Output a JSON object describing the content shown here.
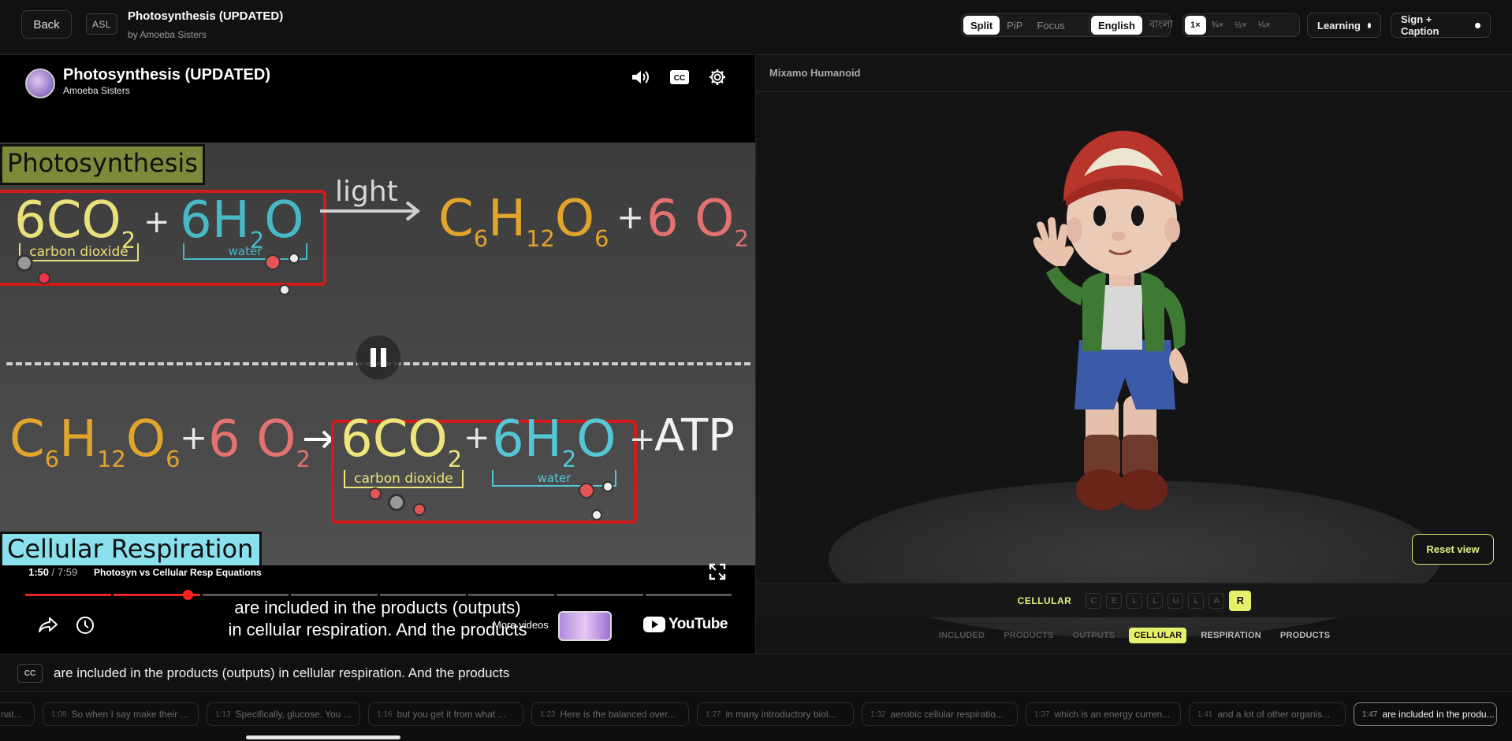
{
  "header": {
    "back_label": "Back",
    "asl_label": "ASL",
    "title": "Photosynthesis (UPDATED)",
    "byline": "by Amoeba Sisters",
    "view_modes": [
      "Split",
      "PiP",
      "Focus"
    ],
    "active_view": "Split",
    "languages": [
      "English",
      "বাংলা"
    ],
    "active_language": "English",
    "speeds": [
      "1×",
      "¾×",
      "½×",
      "¼×"
    ],
    "active_speed": "1×",
    "learning_label": "Learning",
    "sign_caption_label": "Sign + Caption"
  },
  "video": {
    "title": "Photosynthesis (UPDATED)",
    "channel": "Amoeba Sisters",
    "icons": [
      "volume-icon",
      "cc-icon",
      "settings-icon"
    ],
    "scene": {
      "label_top": "Photosynthesis",
      "label_bottom": "Cellular Respiration",
      "light": "light",
      "carbon_dioxide": "carbon dioxide",
      "water": "water",
      "atp": "ATP"
    },
    "current_time": "1:50",
    "duration": "7:59",
    "chapter": "Photosyn vs Cellular Resp Equations",
    "progress": 0.23,
    "caption_line1": "are included in the products (outputs)",
    "caption_line2": "in cellular respiration. And the products",
    "more_videos_label": "More videos",
    "youtube_label": "YouTube"
  },
  "avatar": {
    "title": "Mixamo Humanoid",
    "reset_label": "Reset view",
    "fingerspell_word": "CELLULAR",
    "fingerspell_letters": [
      "C",
      "E",
      "L",
      "L",
      "U",
      "L",
      "A",
      "R"
    ],
    "active_letter_index": 7,
    "glosses": [
      "INCLUDED",
      "PRODUCTS",
      "OUTPUTS",
      "CELLULAR",
      "RESPIRATION",
      "PRODUCTS"
    ],
    "active_gloss_index": 3
  },
  "caption_bar": {
    "cc_label": "CC",
    "text": "are included in the products (outputs) in cellular respiration. And the products"
  },
  "timeline": [
    {
      "time": "",
      "text": "nat..."
    },
    {
      "time": "1:08",
      "text": "So when I say make their ..."
    },
    {
      "time": "1:13",
      "text": "Specifically, glucose. You ..."
    },
    {
      "time": "1:16",
      "text": "but you get it from what ..."
    },
    {
      "time": "1:23",
      "text": "Here is the balanced over..."
    },
    {
      "time": "1:27",
      "text": "in many introductory biol..."
    },
    {
      "time": "1:32",
      "text": "aerobic cellular respiratio..."
    },
    {
      "time": "1:37",
      "text": "which is an energy curren..."
    },
    {
      "time": "1:41",
      "text": "and a lot of other organis..."
    },
    {
      "time": "1:47",
      "text": "are included in the produ..."
    }
  ],
  "colors": {
    "accent": "#e6f06a",
    "progress": "#ee2222",
    "co2_yellow": "#e8e07a",
    "h2o_teal": "#47b9c6",
    "glucose_orange": "#e2a52c",
    "o2_red": "#e27270",
    "box_red": "#d11b1b"
  }
}
